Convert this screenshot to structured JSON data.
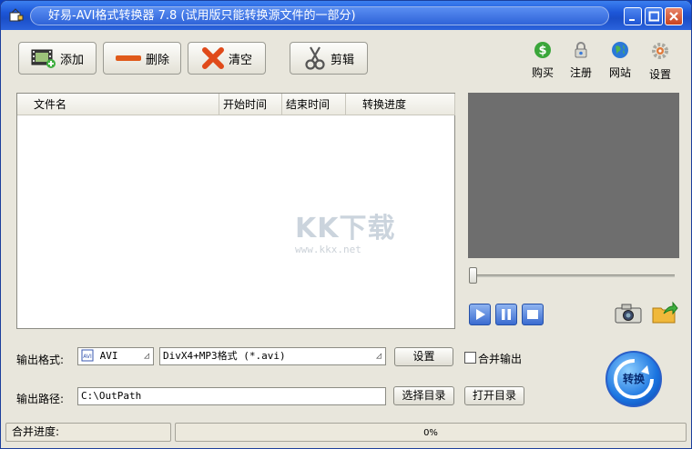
{
  "window": {
    "title": "好易-AVI格式转换器 7.8 (试用版只能转换源文件的一部分)"
  },
  "toolbar": {
    "add_label": "添加",
    "delete_label": "删除",
    "clear_label": "清空",
    "cut_label": "剪辑",
    "buy_label": "购买",
    "register_label": "注册",
    "website_label": "网站",
    "settings_label": "设置"
  },
  "filelist": {
    "columns": [
      "文件名",
      "开始时间",
      "结束时间",
      "转换进度"
    ],
    "rows": []
  },
  "watermark": {
    "brand": "KK下载",
    "url": "www.kkx.net"
  },
  "output": {
    "format_label": "输出格式:",
    "format_value": "AVI",
    "format_desc": "DivX4+MP3格式 (*.avi)",
    "settings_button": "设置",
    "merge_label": "合并输出",
    "merge_checked": false,
    "path_label": "输出路径:",
    "path_value": "C:\\OutPath",
    "choose_dir_button": "选择目录",
    "open_dir_button": "打开目录",
    "convert_button": "转换"
  },
  "status": {
    "merge_progress_label": "合并进度:",
    "progress_text": "0%"
  },
  "colors": {
    "title_bar": "#1c56d8",
    "preview_bg": "#6e6e6e",
    "window_bg": "#e8e6dc"
  }
}
